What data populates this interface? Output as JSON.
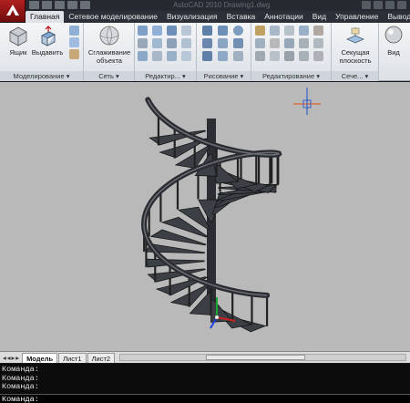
{
  "window": {
    "title": "AutoCAD 2010  Drawing1.dwg"
  },
  "ribbon_tabs": [
    {
      "label": "Главная",
      "active": true
    },
    {
      "label": "Сетевое моделирование",
      "active": false
    },
    {
      "label": "Визуализация",
      "active": false
    },
    {
      "label": "Вставка",
      "active": false
    },
    {
      "label": "Аннотации",
      "active": false
    },
    {
      "label": "Вид",
      "active": false
    },
    {
      "label": "Управление",
      "active": false
    },
    {
      "label": "Вывод",
      "active": false
    }
  ],
  "ribbon": {
    "box_label": "Ящик",
    "extrude_label": "Выдавить",
    "smooth_label": "Сглаживание объекта",
    "section_label": "Секущая плоскость",
    "view_label": "Вид",
    "panels": {
      "modeling": "Моделирование",
      "mesh": "Сеть",
      "solid_edit": "Редактир...",
      "draw": "Рисование",
      "modify": "Редактирование",
      "section": "Сече..."
    }
  },
  "layout_tabs": [
    {
      "label": "Модель",
      "active": true
    },
    {
      "label": "Лист1",
      "active": false
    },
    {
      "label": "Лист2",
      "active": false
    }
  ],
  "command_history": [
    "Команда:",
    "Команда:",
    "Команда:"
  ],
  "command_prompt": "Команда:",
  "colors": {
    "viewport_bg": "#b9b9b9",
    "ribbon_bg": "#e6e9ed",
    "command_bg": "#0c0c0c",
    "crosshair": "#e8500a",
    "stair_fill": "#3c3f45"
  }
}
